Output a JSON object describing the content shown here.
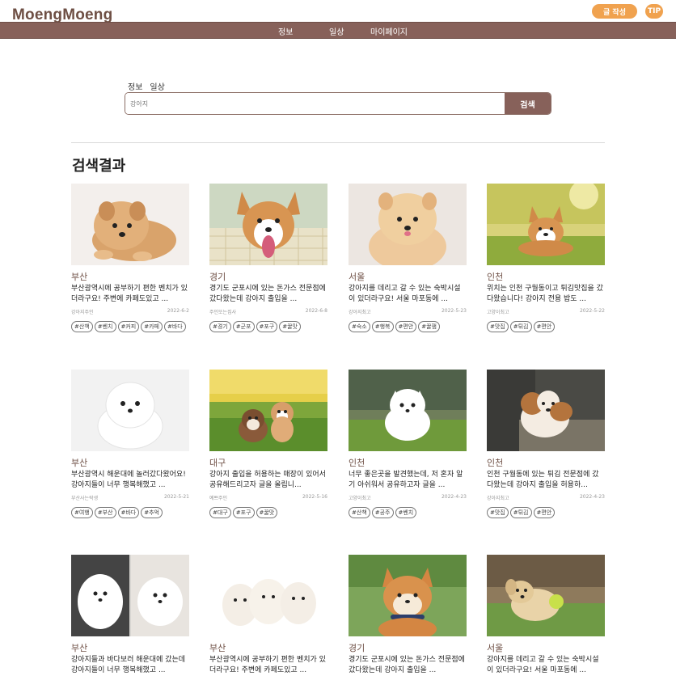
{
  "header": {
    "logo": "MoengMoeng",
    "write_label": "글 작성",
    "tip_label": "TIP"
  },
  "nav": {
    "items": [
      "정보",
      "일상",
      "마이페이지"
    ]
  },
  "search": {
    "tags": [
      "정보",
      "일상"
    ],
    "value": "강아지",
    "button_label": "검색"
  },
  "results": {
    "title": "검색결과",
    "cards": [
      {
        "region": "부산",
        "desc": "부산광역시에 공부하기 편한 벤치가 있더라구요! 주변에 카페도있고 ...",
        "author": "강아지주인",
        "date": "2022-6-2",
        "tags": [
          "#산책",
          "#벤치",
          "#커피",
          "#카페",
          "#바다"
        ],
        "icon": "pomeranian-lying"
      },
      {
        "region": "경기",
        "desc": "경기도 군포시에 있는 돈가스 전문점에 갔다왔는데 강아지 출입을 ...",
        "author": "주인또는집사",
        "date": "2022-6-8",
        "tags": [
          "#경기",
          "#군포",
          "#포구",
          "#꿀맛"
        ],
        "icon": "corgi-picnic"
      },
      {
        "region": "서울",
        "desc": "강아지를 데리고 갈 수 있는 숙박시설이 있더라구요! 서울 마포동에 ...",
        "author": "강아지최고",
        "date": "2022-5-23",
        "tags": [
          "#숙소",
          "#행복",
          "#편안",
          "#꿀잼"
        ],
        "icon": "pomeranian-sitting"
      },
      {
        "region": "인천",
        "desc": "위치는 인천 구월동이고 튀김맛집을 갔다왔습니다! 강아지 전용 밥도 ...",
        "author": "고양이최고",
        "date": "2022-5-22",
        "tags": [
          "#맛집",
          "#튀김",
          "#편안"
        ],
        "icon": "corgi-field"
      },
      {
        "region": "부산",
        "desc": "부산광역시 해운대에 놀러갔다왔어요! 강아지들이 너무 행복해했고 ...",
        "author": "부산사는락생",
        "date": "2022-5-21",
        "tags": [
          "#여행",
          "#부산",
          "#바다",
          "#추억"
        ],
        "icon": "white-pom"
      },
      {
        "region": "대구",
        "desc": "강아지 출입을 허용하는 매장이 있어서 공유해드리고자 글을 올립니...",
        "author": "예쁘주인",
        "date": "2022-5-16",
        "tags": [
          "#대구",
          "#포구",
          "#꿀맛"
        ],
        "icon": "two-puppies"
      },
      {
        "region": "인천",
        "desc": "너무 좋은곳을 발견했는데, 저 혼자 알기 아쉬워서 공유하고자 글을 ...",
        "author": "고양이최고",
        "date": "2022-4-23",
        "tags": [
          "#산책",
          "#공주",
          "#벤치"
        ],
        "icon": "white-spitz-grass"
      },
      {
        "region": "인천",
        "desc": "인천 구월동에 있는 튀김 전문점에 갔다왔는데 강아지 출입을 허용하...",
        "author": "강아지최고",
        "date": "2022-4-23",
        "tags": [
          "#맛집",
          "#튀김",
          "#편안"
        ],
        "icon": "jack-russell"
      },
      {
        "region": "부산",
        "desc": "강아지들과 바다보러 해운대에 갔는데 강아지들이 너무 행복해했고 ...",
        "author": "",
        "date": "",
        "tags": [],
        "icon": "two-white-poms"
      },
      {
        "region": "부산",
        "desc": "부산광역시에 공부하기 편한 벤치가 있더라구요! 주변에 카페도있고 ...",
        "author": "",
        "date": "",
        "tags": [],
        "icon": "three-maltese"
      },
      {
        "region": "경기",
        "desc": "경기도 군포시에 있는 돈가스 전문점에 갔다왔는데 강아지 출입을 ...",
        "author": "",
        "date": "",
        "tags": [],
        "icon": "shiba"
      },
      {
        "region": "서울",
        "desc": "강아지를 데리고 갈 수 있는 숙박시설이 있더라구요! 서울 마포동에 ...",
        "author": "",
        "date": "",
        "tags": [],
        "icon": "lab-ball"
      }
    ]
  }
}
